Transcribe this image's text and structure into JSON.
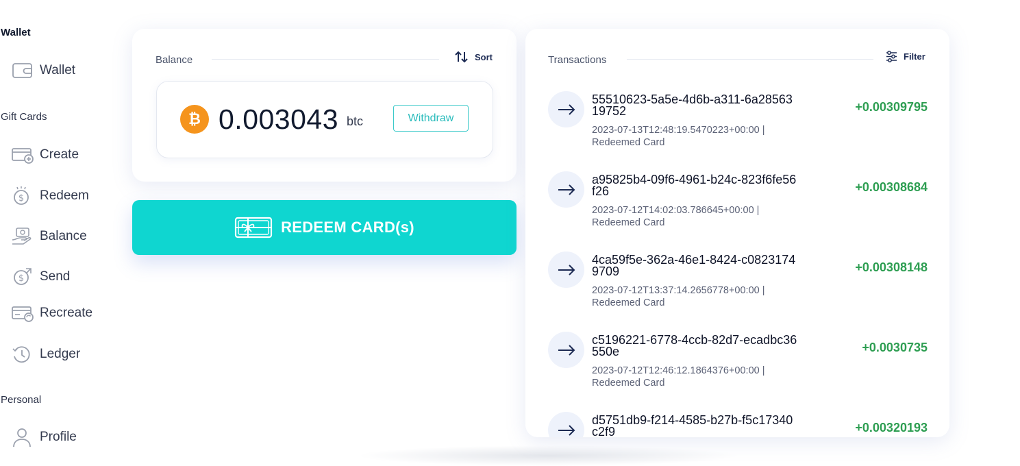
{
  "sidebar": {
    "wallet_section": "Wallet",
    "giftcards_section": "Gift Cards",
    "personal_section": "Personal",
    "items": {
      "wallet": "Wallet",
      "create": "Create",
      "redeem": "Redeem",
      "balance": "Balance",
      "send": "Send",
      "recreate": "Recreate",
      "ledger": "Ledger",
      "profile": "Profile"
    }
  },
  "balance_card": {
    "title": "Balance",
    "sort_label": "Sort",
    "amount": "0.003043",
    "unit": "btc",
    "coin_symbol": "₿",
    "withdraw_label": "Withdraw"
  },
  "redeem_button": {
    "label": "REDEEM CARD(s)"
  },
  "transactions": {
    "title": "Transactions",
    "filter_label": "Filter",
    "items": [
      {
        "id": "55510623-5a5e-4d6b-a311-6a2856319752",
        "timestamp": "2023-07-13T12:48:19.5470223+00:00 |",
        "type": "Redeemed Card",
        "amount": "+0.00309795"
      },
      {
        "id": "a95825b4-09f6-4961-b24c-823f6fe56f26",
        "timestamp": "2023-07-12T14:02:03.786645+00:00 |",
        "type": "Redeemed Card",
        "amount": "+0.00308684"
      },
      {
        "id": "4ca59f5e-362a-46e1-8424-c08231749709",
        "timestamp": "2023-07-12T13:37:14.2656778+00:00 |",
        "type": "Redeemed Card",
        "amount": "+0.00308148"
      },
      {
        "id": "c5196221-6778-4ccb-82d7-ecadbc36550e",
        "timestamp": "2023-07-12T12:46:12.1864376+00:00 |",
        "type": "Redeemed Card",
        "amount": "+0.0030735"
      },
      {
        "id": "d5751db9-f214-4585-b27b-f5c17340c2f9",
        "timestamp": "",
        "type": "",
        "amount": "+0.00320193"
      }
    ]
  },
  "colors": {
    "accent_teal": "#0fd6d0",
    "positive_green": "#2e9e52",
    "bitcoin_orange": "#f5941d",
    "navy": "#1d2b54"
  }
}
